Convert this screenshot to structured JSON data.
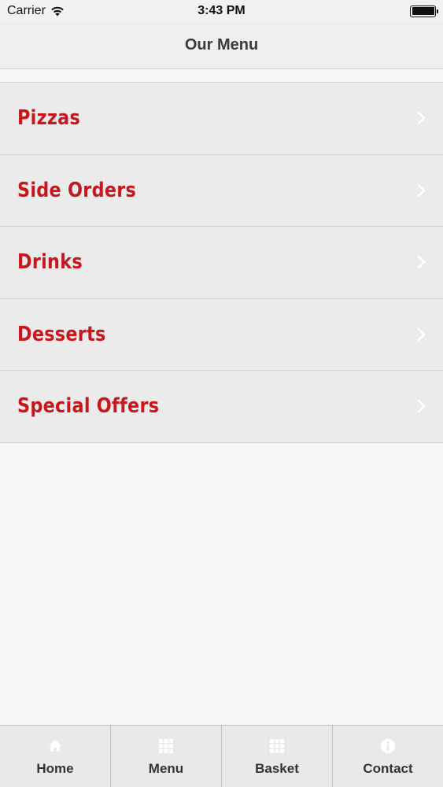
{
  "status_bar": {
    "carrier": "Carrier",
    "time": "3:43 PM"
  },
  "nav": {
    "title": "Our Menu"
  },
  "menu": {
    "items": [
      {
        "label": "Pizzas"
      },
      {
        "label": "Side Orders"
      },
      {
        "label": "Drinks"
      },
      {
        "label": "Desserts"
      },
      {
        "label": "Special Offers"
      }
    ]
  },
  "tabs": [
    {
      "label": "Home",
      "icon": "home-icon"
    },
    {
      "label": "Menu",
      "icon": "grid-icon"
    },
    {
      "label": "Basket",
      "icon": "grid-icon"
    },
    {
      "label": "Contact",
      "icon": "info-icon"
    }
  ],
  "colors": {
    "accent": "#c8171c",
    "item_background": "#ebebeb",
    "page_background": "#f7f7f8"
  }
}
